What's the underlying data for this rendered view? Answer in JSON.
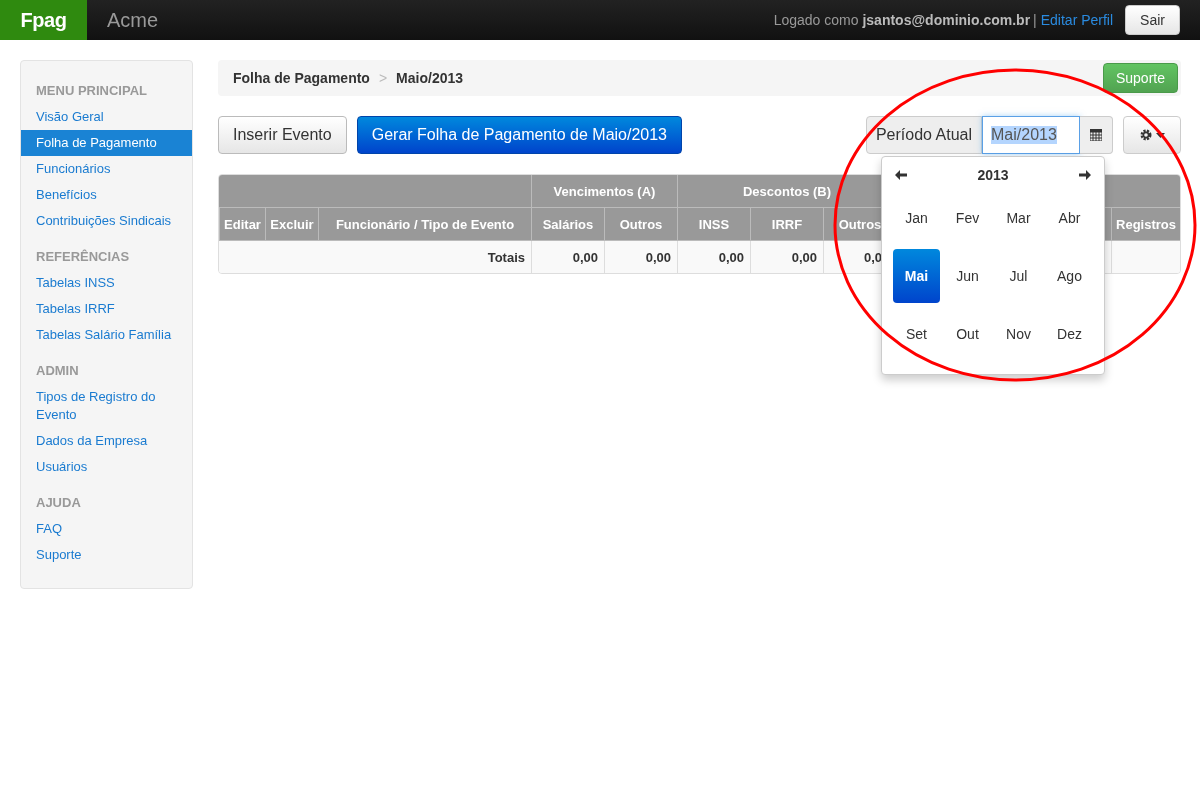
{
  "navbar": {
    "brand": "Fpag",
    "app_name": "Acme",
    "login_prefix": "Logado como",
    "user": "jsantos@dominio.com.br",
    "separator": "|",
    "edit_profile": "Editar Perfil",
    "logout": "Sair"
  },
  "sidebar": {
    "sections": [
      {
        "header": "MENU PRINCIPAL",
        "items": [
          {
            "label": "Visão Geral",
            "selected": false
          },
          {
            "label": "Folha de Pagamento",
            "selected": true
          },
          {
            "label": "Funcionários",
            "selected": false
          },
          {
            "label": "Benefícios",
            "selected": false
          },
          {
            "label": "Contribuições Sindicais",
            "selected": false
          }
        ]
      },
      {
        "header": "REFERÊNCIAS",
        "items": [
          {
            "label": "Tabelas INSS",
            "selected": false
          },
          {
            "label": "Tabelas IRRF",
            "selected": false
          },
          {
            "label": "Tabelas Salário Família",
            "selected": false
          }
        ]
      },
      {
        "header": "ADMIN",
        "items": [
          {
            "label": "Tipos de Registro do Evento",
            "selected": false
          },
          {
            "label": "Dados da Empresa",
            "selected": false
          },
          {
            "label": "Usuários",
            "selected": false
          }
        ]
      },
      {
        "header": "AJUDA",
        "items": [
          {
            "label": "FAQ",
            "selected": false
          },
          {
            "label": "Suporte",
            "selected": false
          }
        ]
      }
    ]
  },
  "breadcrumb": {
    "items": [
      "Folha de Pagamento",
      "Maio/2013"
    ],
    "separator": ">"
  },
  "support_button": "Suporte",
  "toolbar": {
    "insert_button": "Inserir Evento",
    "generate_button": "Gerar Folha de Pagamento de Maio/2013",
    "period_label": "Período Atual",
    "period_value": "Mai/2013"
  },
  "table": {
    "groups": [
      "Vencimentos (A)",
      "Descontos (B)"
    ],
    "columns": [
      "Editar",
      "Excluir",
      "Funcionário / Tipo de Evento",
      "Salários",
      "Outros",
      "INSS",
      "IRRF",
      "Outros",
      "Registros"
    ],
    "totals": {
      "label": "Totais",
      "values": [
        "0,00",
        "0,00",
        "0,00",
        "0,00",
        "0,0"
      ]
    }
  },
  "datepicker": {
    "year": "2013",
    "months": [
      {
        "label": "Jan",
        "selected": false
      },
      {
        "label": "Fev",
        "selected": false
      },
      {
        "label": "Mar",
        "selected": false
      },
      {
        "label": "Abr",
        "selected": false
      },
      {
        "label": "Mai",
        "selected": true
      },
      {
        "label": "Jun",
        "selected": false
      },
      {
        "label": "Jul",
        "selected": false
      },
      {
        "label": "Ago",
        "selected": false
      },
      {
        "label": "Set",
        "selected": false
      },
      {
        "label": "Out",
        "selected": false
      },
      {
        "label": "Nov",
        "selected": false
      },
      {
        "label": "Dez",
        "selected": false
      }
    ]
  }
}
